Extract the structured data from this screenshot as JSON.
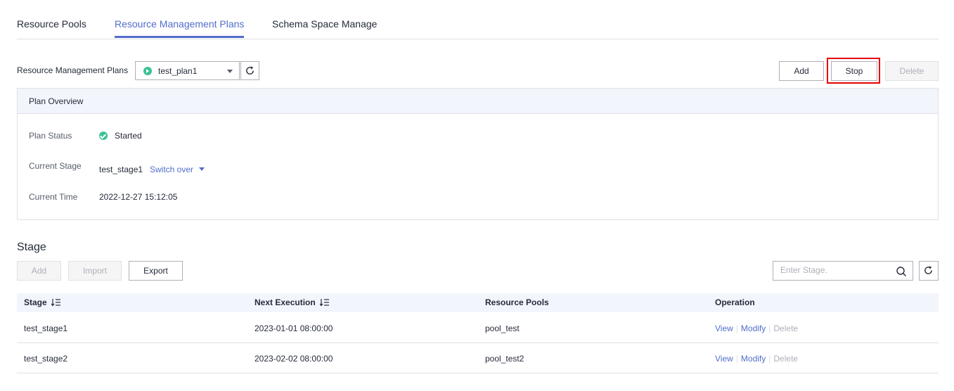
{
  "tabs": [
    {
      "label": "Resource Pools",
      "active": false
    },
    {
      "label": "Resource Management Plans",
      "active": true
    },
    {
      "label": "Schema Space Manage",
      "active": false
    }
  ],
  "plan_selector": {
    "label": "Resource Management Plans",
    "selected": "test_plan1",
    "status_color": "#3ac295"
  },
  "actions": {
    "add": "Add",
    "stop": "Stop",
    "delete": "Delete",
    "highlighted": "stop",
    "highlight_color": "#e60000"
  },
  "overview": {
    "title": "Plan Overview",
    "status_label": "Plan Status",
    "status_value": "Started",
    "stage_label": "Current Stage",
    "stage_value": "test_stage1",
    "switch_label": "Switch over",
    "time_label": "Current Time",
    "time_value": "2022-12-27 15:12:05"
  },
  "stage_section": {
    "title": "Stage",
    "add": "Add",
    "import": "Import",
    "export": "Export",
    "search_placeholder": "Enter Stage."
  },
  "table": {
    "columns": [
      "Stage",
      "Next Execution",
      "Resource Pools",
      "Operation"
    ],
    "rows": [
      {
        "stage": "test_stage1",
        "next_execution": "2023-01-01 08:00:00",
        "resource_pools": "pool_test"
      },
      {
        "stage": "test_stage2",
        "next_execution": "2023-02-02 08:00:00",
        "resource_pools": "pool_test2"
      }
    ],
    "operations": {
      "view": "View",
      "modify": "Modify",
      "delete": "Delete"
    }
  },
  "colors": {
    "accent": "#526ecc",
    "success": "#3ac295",
    "header_bg": "#f2f5fc"
  }
}
